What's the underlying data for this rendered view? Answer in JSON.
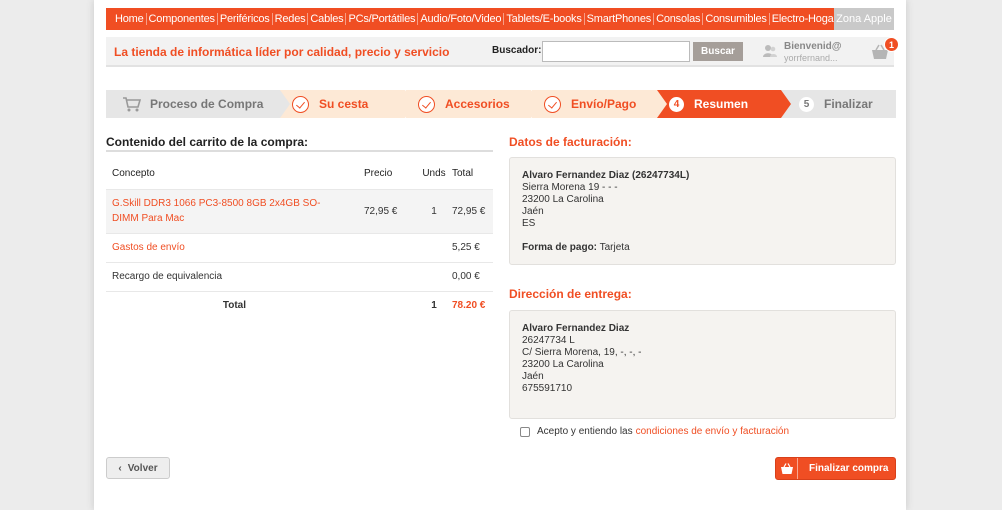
{
  "nav": {
    "items": [
      "Home",
      "Componentes",
      "Periféricos",
      "Redes",
      "Cables",
      "PCs/Portátiles",
      "Audio/Foto/Video",
      "Tablets/E-books",
      "SmartPhones",
      "Consolas",
      "Consumibles",
      "Electro-Hogar"
    ],
    "apple": "Zona Apple"
  },
  "header": {
    "tagline": "La tienda de informática líder por calidad, precio y servicio",
    "search_label": "Buscador:",
    "search_value": "",
    "search_button": "Buscar",
    "user_title": "Bienvenid@",
    "user_name": "yorrfernand...",
    "cart_count": "1"
  },
  "steps": {
    "process": "Proceso de Compra",
    "s1": "Su cesta",
    "s2": "Accesorios",
    "s3": "Envío/Pago",
    "s4_num": "4",
    "s4": "Resumen",
    "s5_num": "5",
    "s5": "Finalizar"
  },
  "cart": {
    "title": "Contenido del carrito de la compra:",
    "headers": {
      "concept": "Concepto",
      "price": "Precio",
      "units": "Unds",
      "total": "Total"
    },
    "item": {
      "concept": "G.Skill DDR3 1066 PC3-8500 8GB 2x4GB SO-DIMM Para Mac",
      "price": "72,95 €",
      "units": "1",
      "total": "72,95 €"
    },
    "shipping": {
      "concept": "Gastos de envío",
      "total": "5,25 €"
    },
    "surcharge": {
      "concept": "Recargo de equivalencia",
      "total": "0,00 €"
    },
    "summary": {
      "label": "Total",
      "units": "1",
      "total": "78.20 €"
    }
  },
  "billing": {
    "title": "Datos de facturación:",
    "name": "Alvaro Fernandez Diaz (26247734L)",
    "street": "Sierra Morena 19 - - -",
    "city": "23200 La Carolina",
    "province": "Jaén",
    "country": "ES",
    "payment_label": "Forma de pago:",
    "payment_value": "Tarjeta"
  },
  "delivery": {
    "title": "Dirección de entrega:",
    "name": "Alvaro Fernandez Diaz",
    "id": "26247734 L",
    "street": "C/ Sierra Morena, 19, -, -, -",
    "city": "23200 La Carolina",
    "province": "Jaén",
    "phone": "675591710"
  },
  "terms": {
    "text": "Acepto y entiendo las",
    "link": "condiciones de envío y facturación"
  },
  "buttons": {
    "back": "Volver",
    "finish": "Finalizar compra"
  },
  "colors": {
    "accent": "#f04e23",
    "step_done_bg": "#fde9d6",
    "neutral": "#e6e6e6"
  }
}
